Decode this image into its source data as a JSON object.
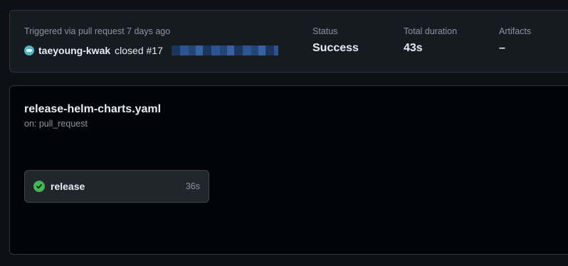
{
  "summary": {
    "trigger_text": "Triggered via pull request 7 days ago",
    "user": "taeyoung-kwak",
    "action": "closed #17",
    "status_label": "Status",
    "status_value": "Success",
    "duration_label": "Total duration",
    "duration_value": "43s",
    "artifacts_label": "Artifacts",
    "artifacts_value": "–"
  },
  "workflow": {
    "name": "release-helm-charts.yaml",
    "on": "on: pull_request",
    "jobs": [
      {
        "name": "release",
        "duration": "36s",
        "status": "success"
      }
    ]
  },
  "colors": {
    "success": "#3fb950",
    "background": "#0d1117",
    "card": "#161b22",
    "border": "#30363d"
  },
  "icons": {
    "job_status": "check-circle-icon",
    "avatar": "user-avatar"
  }
}
